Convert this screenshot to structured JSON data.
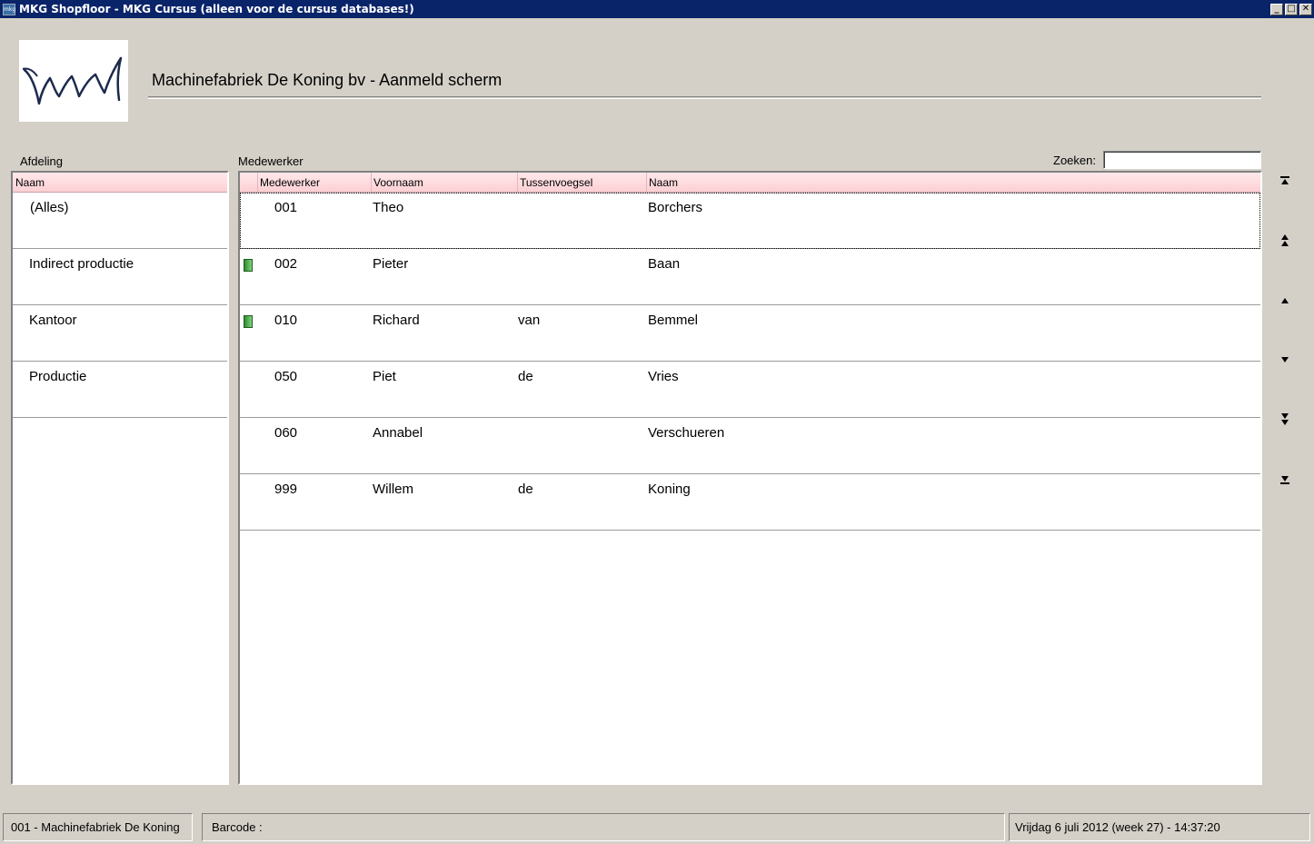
{
  "window": {
    "title": "MKG Shopfloor - MKG Cursus (alleen voor de cursus databases!)",
    "app_icon_text": "mkg",
    "minimize": "_",
    "maximize": "□",
    "close": "✕"
  },
  "header": {
    "title": "Machinefabriek De Koning bv  -  Aanmeld scherm"
  },
  "afdeling": {
    "label": "Afdeling",
    "columns": [
      "Naam"
    ],
    "rows": [
      "(Alles)",
      "Indirect productie",
      "Kantoor",
      "Productie"
    ]
  },
  "medewerker": {
    "label": "Medewerker",
    "search_label": "Zoeken:",
    "search_value": "",
    "columns": [
      "Medewerker",
      "Voornaam",
      "Tussenvoegsel",
      "Naam"
    ],
    "rows": [
      {
        "nr": "001",
        "voornaam": "Theo",
        "tussenvoegsel": "",
        "naam": "Borchers",
        "present": false
      },
      {
        "nr": "002",
        "voornaam": "Pieter",
        "tussenvoegsel": "",
        "naam": "Baan",
        "present": true
      },
      {
        "nr": "010",
        "voornaam": "Richard",
        "tussenvoegsel": "van",
        "naam": "Bemmel",
        "present": true
      },
      {
        "nr": "050",
        "voornaam": "Piet",
        "tussenvoegsel": "de",
        "naam": "Vries",
        "present": false
      },
      {
        "nr": "060",
        "voornaam": "Annabel",
        "tussenvoegsel": "",
        "naam": "Verschueren",
        "present": false
      },
      {
        "nr": "999",
        "voornaam": "Willem",
        "tussenvoegsel": "de",
        "naam": "Koning",
        "present": false
      }
    ]
  },
  "navigation": [
    "first-icon",
    "page-up-icon",
    "up-icon",
    "down-icon",
    "page-down-icon",
    "last-icon"
  ],
  "statusbar": {
    "company": "001 - Machinefabriek De Koning",
    "barcode": "Barcode :",
    "datetime": "Vrijdag 6 juli 2012 (week 27)  -  14:37:20"
  },
  "colors": {
    "titlebar": "#0a246a",
    "grid_header": "#fcd0d4",
    "present_indicator": "#3fa33f"
  }
}
